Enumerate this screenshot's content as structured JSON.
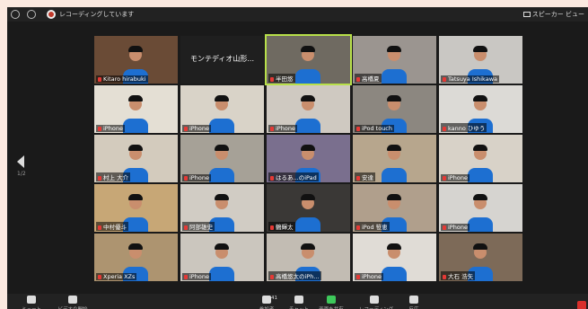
{
  "recording_text": "レコーディングしています",
  "view_label": "スピーカー ビュー",
  "pager": "1/2",
  "tiles": [
    {
      "name": "Kitaro hirabuki",
      "bg": "#6a4b36"
    },
    {
      "name": "",
      "bg": "#1f1f1f",
      "center": "モンテディオ山形..."
    },
    {
      "name": "半田悠",
      "bg": "#6f6a61"
    },
    {
      "name": "高橋夏",
      "bg": "#9b9590"
    },
    {
      "name": "Tatsuya Ishikawa",
      "bg": "#c9c7c3"
    },
    {
      "name": "iPhone",
      "bg": "#e4dfd4"
    },
    {
      "name": "iPhone",
      "bg": "#d9d3c8"
    },
    {
      "name": "iPhone",
      "bg": "#cfc9c1"
    },
    {
      "name": "iPod touch",
      "bg": "#8c8780"
    },
    {
      "name": "kanno ひゆう",
      "bg": "#dcdad6"
    },
    {
      "name": "村上 大介",
      "bg": "#d3cbbd"
    },
    {
      "name": "iPhone",
      "bg": "#a6a197"
    },
    {
      "name": "はるあ...のiPad",
      "bg": "#7a6f8e"
    },
    {
      "name": "安達",
      "bg": "#b7a68d"
    },
    {
      "name": "iPhone",
      "bg": "#d8d2c8"
    },
    {
      "name": "中村優斗",
      "bg": "#c7a776"
    },
    {
      "name": "阿部雄史",
      "bg": "#d1ccc4"
    },
    {
      "name": "鶴輝太",
      "bg": "#3a3836"
    },
    {
      "name": "iPod 笹恵",
      "bg": "#b09f8c"
    },
    {
      "name": "iPhone",
      "bg": "#d6d4d0"
    },
    {
      "name": "Xperia XZs",
      "bg": "#ad9470"
    },
    {
      "name": "iPhone",
      "bg": "#cbc6be"
    },
    {
      "name": "高橋悠太のiPh...",
      "bg": "#c2bcb3"
    },
    {
      "name": "iPhone",
      "bg": "#e0dcd6"
    },
    {
      "name": "大石 浩矢",
      "bg": "#7d6a58"
    }
  ],
  "toolbar": [
    {
      "label": "ミュート",
      "icon": "microphone-icon"
    },
    {
      "label": "ビデオの開始",
      "icon": "video-camera-icon"
    },
    {
      "label": "参加者",
      "icon": "participants-icon",
      "count": "41"
    },
    {
      "label": "チャット",
      "icon": "chat-icon"
    },
    {
      "label": "画面を共有",
      "icon": "share-screen-icon"
    },
    {
      "label": "レコーディング",
      "icon": "record-icon"
    },
    {
      "label": "反応",
      "icon": "reaction-icon"
    }
  ]
}
